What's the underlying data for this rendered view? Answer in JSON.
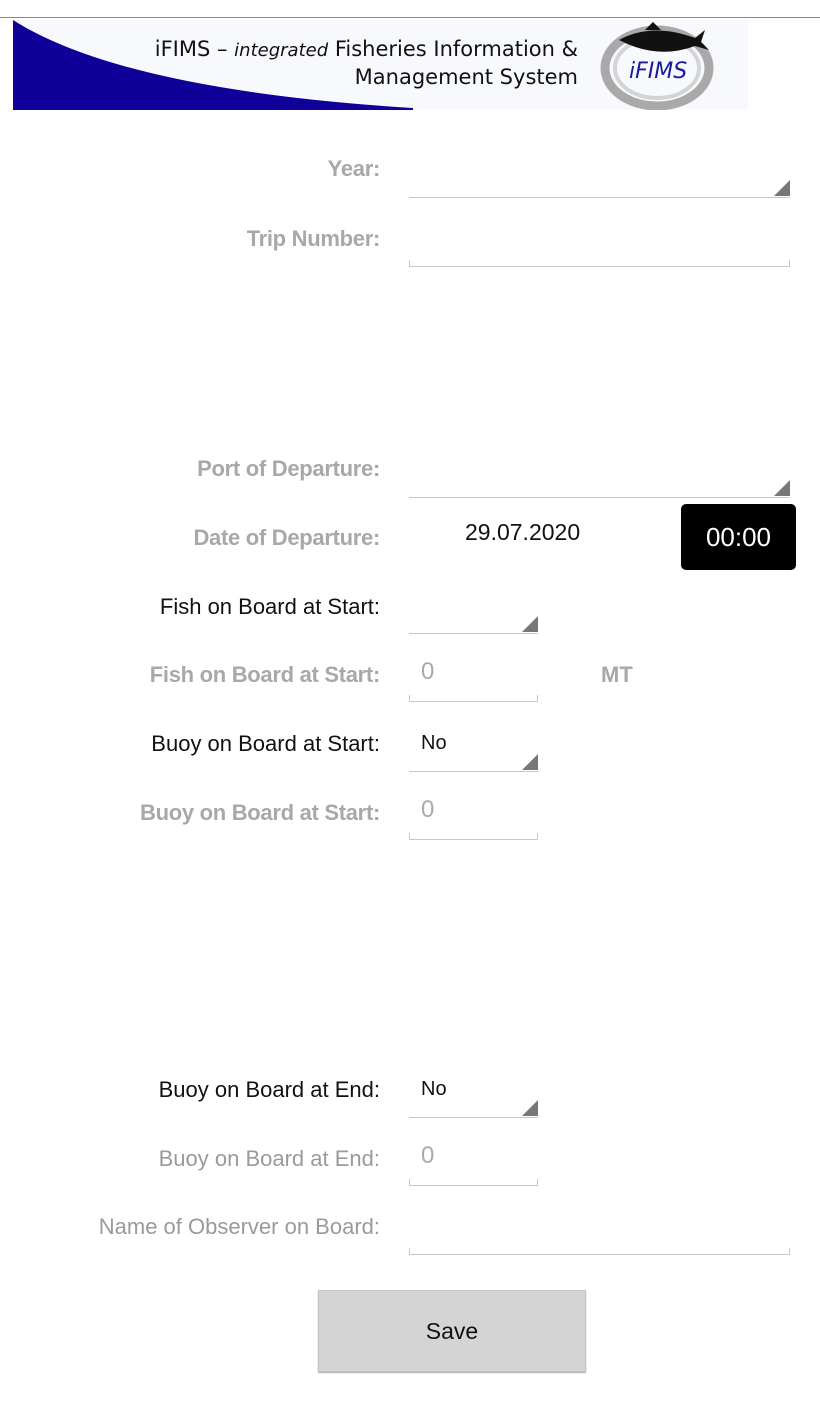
{
  "banner": {
    "line1_prefix": "iFIMS – ",
    "line1_italic": "integrated",
    "line1_suffix": " Fisheries Information &",
    "line2": "Management System",
    "logo_text": "iFIMS",
    "brand_color": "#10009a"
  },
  "form": {
    "year_label": "Year:",
    "year_value": "",
    "trip_number_label": "Trip Number:",
    "trip_number_value": "",
    "port_of_departure_label": "Port of Departure:",
    "port_of_departure_value": "",
    "date_of_departure_label": "Date of Departure:",
    "date_of_departure_value": "29.07.2020",
    "time_of_departure_value": "00:00",
    "fish_on_board_start_select_label": "Fish on Board at Start:",
    "fish_on_board_start_select_value": "",
    "fish_on_board_start_qty_label": "Fish on Board at Start:",
    "fish_on_board_start_qty_value": "0",
    "fish_on_board_start_unit": "MT",
    "buoy_on_board_start_select_label": "Buoy on Board at Start:",
    "buoy_on_board_start_select_value": "No",
    "buoy_on_board_start_qty_label": "Buoy on Board at Start:",
    "buoy_on_board_start_qty_value": "0",
    "buoy_on_board_end_select_label": "Buoy on Board at End:",
    "buoy_on_board_end_select_value": "No",
    "buoy_on_board_end_qty_label": "Buoy on Board at End:",
    "buoy_on_board_end_qty_value": "0",
    "observer_name_label": "Name of Observer on Board:",
    "observer_name_value": ""
  },
  "actions": {
    "save_label": "Save"
  },
  "icons": {
    "dropdown": "dropdown-triangle-icon",
    "logo_fish": "fish-icon"
  }
}
